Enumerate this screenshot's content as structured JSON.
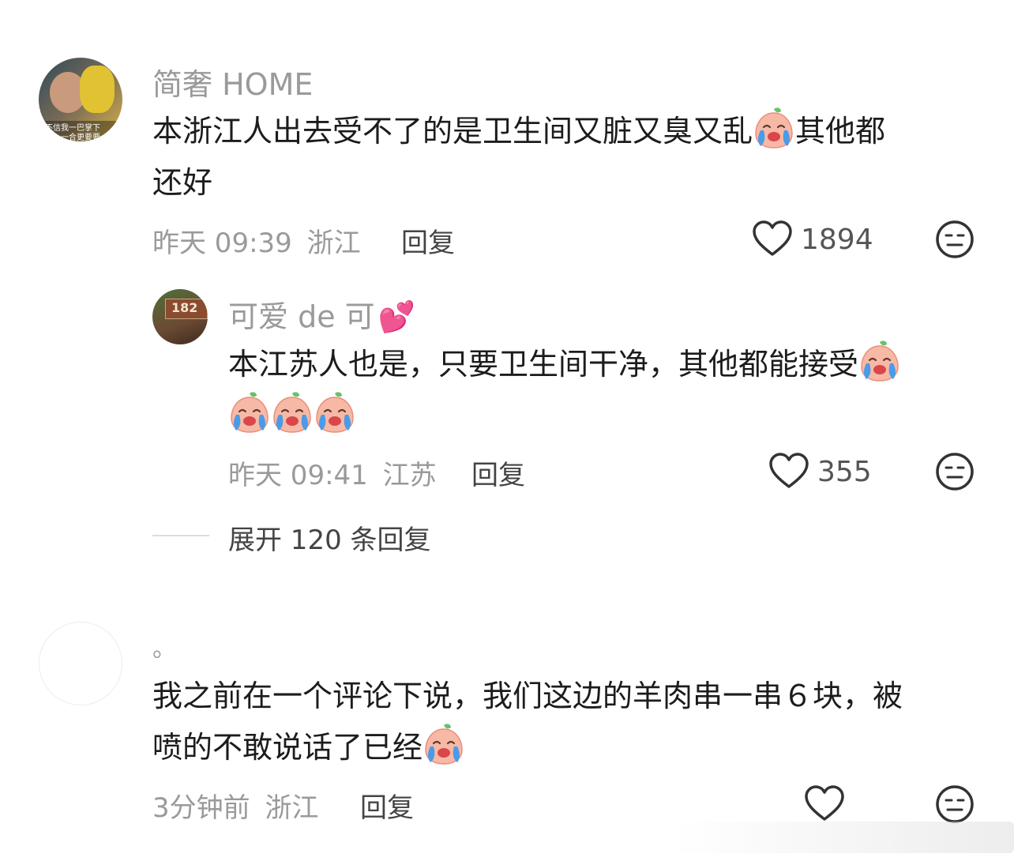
{
  "comments": [
    {
      "username": "简奢 HOME",
      "avatar_text": [
        "不信我一巴掌下",
        "一合更要要"
      ],
      "line1": "本浙江人出去受不了的是卫生间又脏又臭又乱",
      "line1_after": "其他都",
      "line2": "还好",
      "emoji": "loudly-crying-peach-emoji",
      "time": "昨天 09:39",
      "location": "浙江",
      "reply_label": "回复",
      "likes": "1894",
      "reply": {
        "username": "可爱 de 可",
        "username_emoji": "💕",
        "avatar_text": "182",
        "line1": "本江苏人也是，只要卫生间干净，其他都能接受",
        "time": "昨天 09:41",
        "location": "江苏",
        "reply_label": "回复",
        "likes": "355"
      },
      "expand_label": "展开 120 条回复"
    },
    {
      "username": "。",
      "line1": "我之前在一个评论下说，我们这边的羊肉串一串６块，被",
      "line2": "喷的不敢说话了已经",
      "time": "3分钟前",
      "location": "浙江",
      "reply_label": "回复"
    }
  ],
  "colors": {
    "muted": "#9a9a9a",
    "text": "#1c1c1c",
    "emoji_face": "#f7b9a6",
    "emoji_tears": "#4a9be8",
    "emoji_leaf": "#6cc06c"
  },
  "icons": {
    "like": "heart-outline-icon",
    "dislike": "meh-face-icon"
  }
}
